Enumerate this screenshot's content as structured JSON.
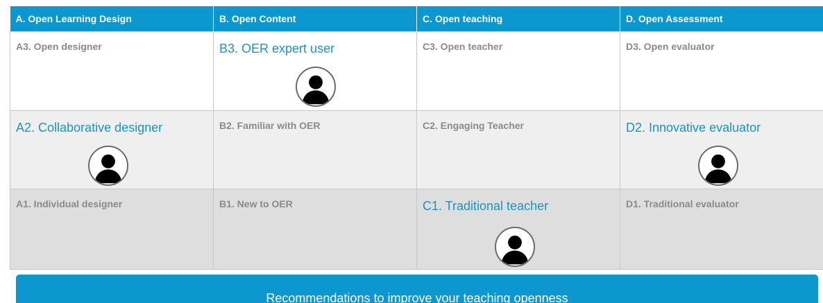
{
  "columns": [
    {
      "label": "A. Open Learning Design"
    },
    {
      "label": "B. Open Content"
    },
    {
      "label": "C. Open teaching"
    },
    {
      "label": "D. Open Assessment"
    }
  ],
  "rows": [
    {
      "cells": [
        {
          "label": "A3. Open designer",
          "selected": false
        },
        {
          "label": "B3. OER expert user",
          "selected": true
        },
        {
          "label": "C3. Open teacher",
          "selected": false
        },
        {
          "label": "D3. Open evaluator",
          "selected": false
        }
      ]
    },
    {
      "cells": [
        {
          "label": "A2. Collaborative designer",
          "selected": true
        },
        {
          "label": "B2. Familiar with OER",
          "selected": false
        },
        {
          "label": "C2. Engaging Teacher",
          "selected": false
        },
        {
          "label": "D2. Innovative evaluator",
          "selected": true
        }
      ]
    },
    {
      "cells": [
        {
          "label": "A1. Individual designer",
          "selected": false
        },
        {
          "label": "B1. New to OER",
          "selected": false
        },
        {
          "label": "C1. Traditional teacher",
          "selected": true
        },
        {
          "label": "D1. Traditional evaluator",
          "selected": false
        }
      ]
    }
  ],
  "recommendations_button": {
    "label": "Recommendations to improve your teaching openness"
  },
  "colors": {
    "header_blue": "#0c98cf",
    "active_text": "#1b93c9",
    "inactive_text": "#8a8a8a",
    "row_top": "#ffffff",
    "row_middle": "#efefef",
    "row_bottom": "#dedede"
  },
  "icons": {
    "avatar": "user-silhouette-icon"
  }
}
